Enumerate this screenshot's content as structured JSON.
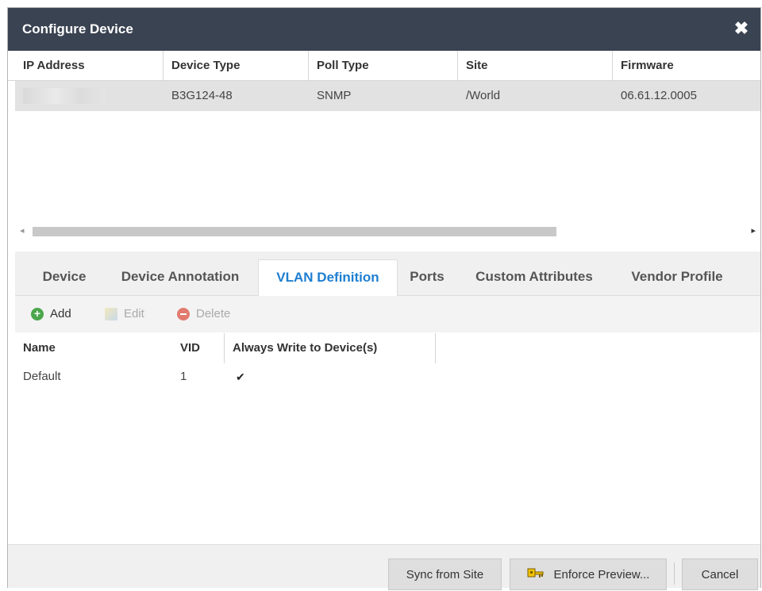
{
  "dialog": {
    "title": "Configure Device",
    "close_glyph": "✖"
  },
  "device_grid": {
    "columns": [
      "IP Address",
      "Device Type",
      "Poll Type",
      "Site",
      "Firmware"
    ],
    "rows": [
      {
        "ip_address": "",
        "device_type": "B3G124-48",
        "poll_type": "SNMP",
        "site": "/World",
        "firmware": "06.61.12.0005"
      }
    ]
  },
  "scrollbar": {
    "left_arrow": "◂",
    "right_arrow": "▸"
  },
  "tabs": [
    {
      "label": "Device",
      "active": false
    },
    {
      "label": "Device Annotation",
      "active": false
    },
    {
      "label": "VLAN Definition",
      "active": true
    },
    {
      "label": "Ports",
      "active": false
    },
    {
      "label": "Custom Attributes",
      "active": false
    },
    {
      "label": "Vendor Profile",
      "active": false
    }
  ],
  "toolbar": {
    "add_label": "Add",
    "edit_label": "Edit",
    "delete_label": "Delete"
  },
  "vlan_grid": {
    "columns": [
      "Name",
      "VID",
      "Always Write to Device(s)"
    ],
    "rows": [
      {
        "name": "Default",
        "vid": "1",
        "always_write": "✔"
      }
    ]
  },
  "footer": {
    "sync_label": "Sync from Site",
    "enforce_label": "Enforce Preview...",
    "cancel_label": "Cancel"
  },
  "colors": {
    "titlebar": "#3a4352",
    "active_tab": "#1e7ed1",
    "add_icon": "#4ca64c",
    "delete_icon": "#e27a6f"
  },
  "icons": {
    "close": "close-icon",
    "add": "add-icon",
    "edit": "edit-icon",
    "delete": "delete-icon",
    "enforce": "key-icon"
  }
}
